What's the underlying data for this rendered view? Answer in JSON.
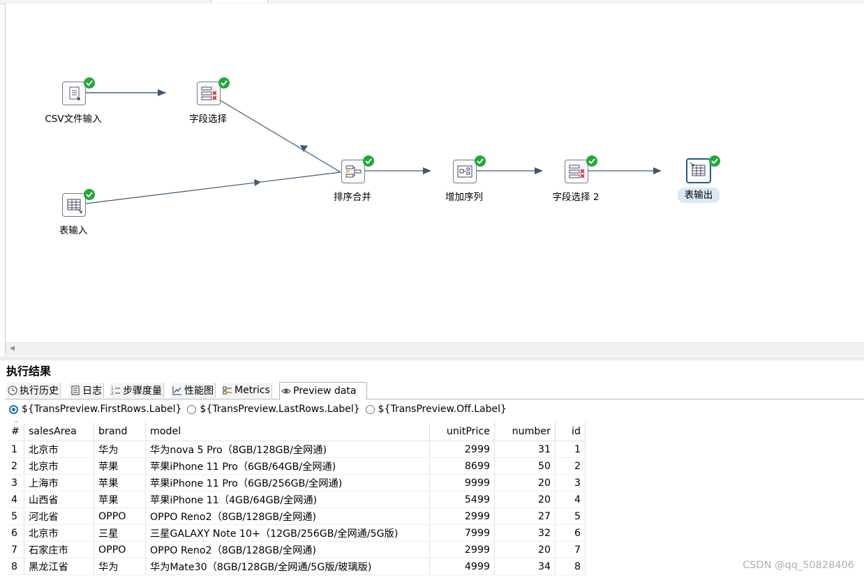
{
  "canvas": {
    "steps": [
      {
        "id": "csv",
        "label": "CSV文件输入",
        "icon": "csv-file-input-icon",
        "selected": false
      },
      {
        "id": "select1",
        "label": "字段选择",
        "icon": "select-values-icon",
        "selected": false
      },
      {
        "id": "table_in",
        "label": "表输入",
        "icon": "table-input-icon",
        "selected": false
      },
      {
        "id": "sort_merge",
        "label": "排序合并",
        "icon": "sorted-merge-icon",
        "selected": false
      },
      {
        "id": "seq",
        "label": "增加序列",
        "icon": "add-sequence-icon",
        "selected": false
      },
      {
        "id": "select2",
        "label": "字段选择 2",
        "icon": "select-values-icon",
        "selected": false
      },
      {
        "id": "table_out",
        "label": "表输出",
        "icon": "table-output-icon",
        "selected": true
      }
    ],
    "status_icon": "check-circle-icon",
    "colors": {
      "hop": "#3d5a73",
      "badge": "#1fa937",
      "selected_bg": "#dce8f4"
    }
  },
  "results": {
    "title": "执行结果",
    "tabs": [
      {
        "label": "执行历史",
        "icon": "clock-icon"
      },
      {
        "label": "日志",
        "icon": "log-icon"
      },
      {
        "label": "步骤度量",
        "icon": "step-metrics-icon"
      },
      {
        "label": "性能图",
        "icon": "chart-icon"
      },
      {
        "label": "Metrics",
        "icon": "metrics-icon"
      },
      {
        "label": "Preview data",
        "icon": "eye-icon",
        "active": true
      }
    ],
    "radios": [
      {
        "label": "${TransPreview.FirstRows.Label}",
        "checked": true
      },
      {
        "label": "${TransPreview.LastRows.Label}",
        "checked": false
      },
      {
        "label": "${TransPreview.Off.Label}",
        "checked": false
      }
    ],
    "columns": [
      "#",
      "salesArea",
      "brand",
      "model",
      "unitPrice",
      "number",
      "id"
    ],
    "rows": [
      [
        "1",
        "北京市",
        "华为",
        "华为nova 5 Pro（8GB/128GB/全网通)",
        "2999",
        "31",
        "1"
      ],
      [
        "2",
        "北京市",
        "苹果",
        "苹果iPhone 11 Pro（6GB/64GB/全网通)",
        "8699",
        "50",
        "2"
      ],
      [
        "3",
        "上海市",
        "苹果",
        "苹果iPhone 11 Pro（6GB/256GB/全网通)",
        "9999",
        "20",
        "3"
      ],
      [
        "4",
        "山西省",
        "苹果",
        "苹果iPhone 11（4GB/64GB/全网通)",
        "5499",
        "20",
        "4"
      ],
      [
        "5",
        "河北省",
        "OPPO",
        "OPPO Reno2（8GB/128GB/全网通)",
        "2999",
        "27",
        "5"
      ],
      [
        "6",
        "北京市",
        "三星",
        "三星GALAXY Note 10+（12GB/256GB/全网通/5G版)",
        "7999",
        "32",
        "6"
      ],
      [
        "7",
        "石家庄市",
        "OPPO",
        "OPPO Reno2（8GB/128GB/全网通)",
        "2999",
        "20",
        "7"
      ],
      [
        "8",
        "黑龙江省",
        "华为",
        "华为Mate30（8GB/128GB/全网通/5G版/玻璃版)",
        "4999",
        "34",
        "8"
      ]
    ]
  },
  "watermark": "CSDN @qq_50828406"
}
